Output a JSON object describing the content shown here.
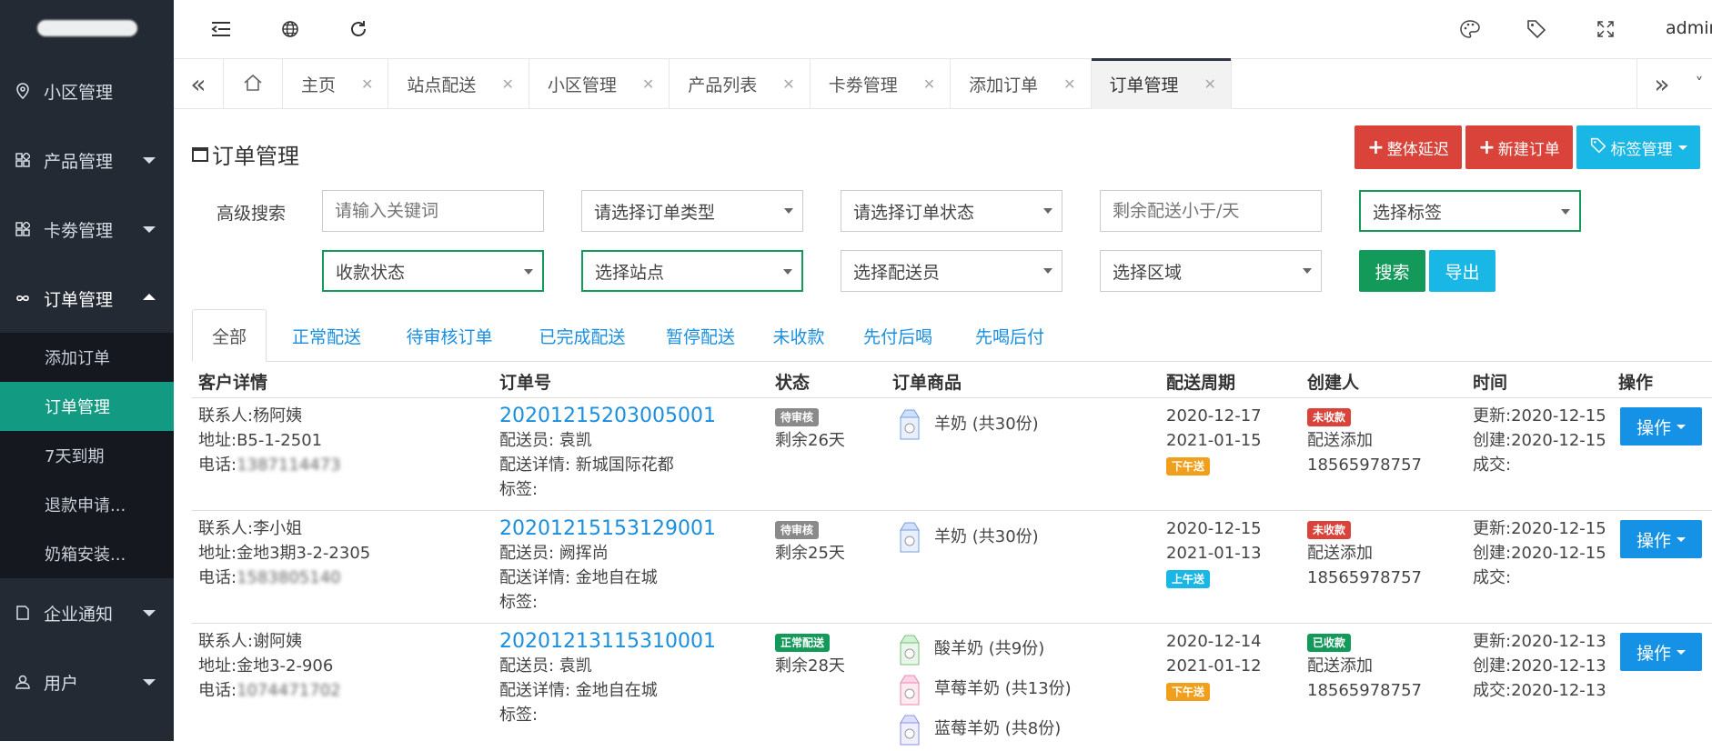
{
  "sidebar": {
    "items": [
      {
        "label": "小区管理"
      },
      {
        "label": "产品管理"
      },
      {
        "label": "卡劵管理"
      },
      {
        "label": "订单管理"
      },
      {
        "label": "企业通知"
      },
      {
        "label": "用户"
      }
    ],
    "order_sub": [
      {
        "label": "添加订单"
      },
      {
        "label": "订单管理"
      },
      {
        "label": "7天到期"
      },
      {
        "label": "退款申请..."
      },
      {
        "label": "奶箱安装..."
      }
    ]
  },
  "header": {
    "user": "admin"
  },
  "tabs": [
    {
      "label": "主页"
    },
    {
      "label": "站点配送"
    },
    {
      "label": "小区管理"
    },
    {
      "label": "产品列表"
    },
    {
      "label": "卡劵管理"
    },
    {
      "label": "添加订单"
    },
    {
      "label": "订单管理"
    }
  ],
  "page": {
    "title": "订单管理",
    "btn_delay": "整体延迟",
    "btn_new": "新建订单",
    "btn_tags": "标签管理"
  },
  "search": {
    "label": "高级搜索",
    "keyword_placeholder": "请输入关键词",
    "order_type": "请选择订单类型",
    "order_status": "请选择订单状态",
    "remaining_placeholder": "剩余配送小于/天",
    "tag": "选择标签",
    "payment_status": "收款状态",
    "station": "选择站点",
    "courier": "选择配送员",
    "area": "选择区域",
    "search_btn": "搜索",
    "export_btn": "导出"
  },
  "order_tabs": [
    {
      "label": "全部"
    },
    {
      "label": "正常配送"
    },
    {
      "label": "待审核订单"
    },
    {
      "label": "已完成配送"
    },
    {
      "label": "暂停配送"
    },
    {
      "label": "未收款"
    },
    {
      "label": "先付后喝"
    },
    {
      "label": "先喝后付"
    }
  ],
  "table": {
    "headers": [
      "客户详情",
      "订单号",
      "状态",
      "订单商品",
      "配送周期",
      "创建人",
      "时间",
      "操作"
    ],
    "op_label": "操作",
    "rows": [
      {
        "contact": "联系人:杨阿姨",
        "address": "地址:B5-1-2501",
        "phone_prefix": "电话:",
        "order_no": "20201215203005001",
        "courier": "配送员: 袁凯",
        "detail": "配送详情: 新城国际花都",
        "tag": "标签:",
        "status_badge": "待审核",
        "remaining": "剩余26天",
        "products": [
          "羊奶 (共30份)"
        ],
        "start": "2020-12-17",
        "end": "2021-01-15",
        "slot": "下午送",
        "pay_badge": "未收款",
        "creator": "配送添加",
        "creator_phone": "18565978757",
        "updated": "更新:2020-12-15",
        "created": "创建:2020-12-15",
        "deal": "成交:"
      },
      {
        "contact": "联系人:李小姐",
        "address": "地址:金地3期3-2-2305",
        "phone_prefix": "电话:",
        "order_no": "20201215153129001",
        "courier": "配送员: 阙挥尚",
        "detail": "配送详情: 金地自在城",
        "tag": "标签:",
        "status_badge": "待审核",
        "remaining": "剩余25天",
        "products": [
          "羊奶 (共30份)"
        ],
        "start": "2020-12-15",
        "end": "2021-01-13",
        "slot": "上午送",
        "pay_badge": "未收款",
        "creator": "配送添加",
        "creator_phone": "18565978757",
        "updated": "更新:2020-12-15",
        "created": "创建:2020-12-15",
        "deal": "成交:"
      },
      {
        "contact": "联系人:谢阿姨",
        "address": "地址:金地3-2-906",
        "phone_prefix": "电话:",
        "order_no": "20201213115310001",
        "courier": "配送员: 袁凯",
        "detail": "配送详情: 金地自在城",
        "tag": "标签:",
        "status_badge": "正常配送",
        "remaining": "剩余28天",
        "products": [
          "酸羊奶 (共9份)",
          "草莓羊奶 (共13份)",
          "蓝莓羊奶 (共8份)"
        ],
        "start": "2020-12-14",
        "end": "2021-01-12",
        "slot": "下午送",
        "pay_badge": "已收款",
        "creator": "配送添加",
        "creator_phone": "18565978757",
        "updated": "更新:2020-12-13",
        "created": "创建:2020-12-13",
        "deal": "成交:2020-12-13"
      }
    ]
  },
  "colors": {
    "sidebar_bg": "#232a33",
    "active_teal": "#139a82",
    "danger": "#d9433a",
    "info": "#18b7e6",
    "success": "#139a5a",
    "primary": "#1592e6",
    "link": "#1a8fe0"
  }
}
